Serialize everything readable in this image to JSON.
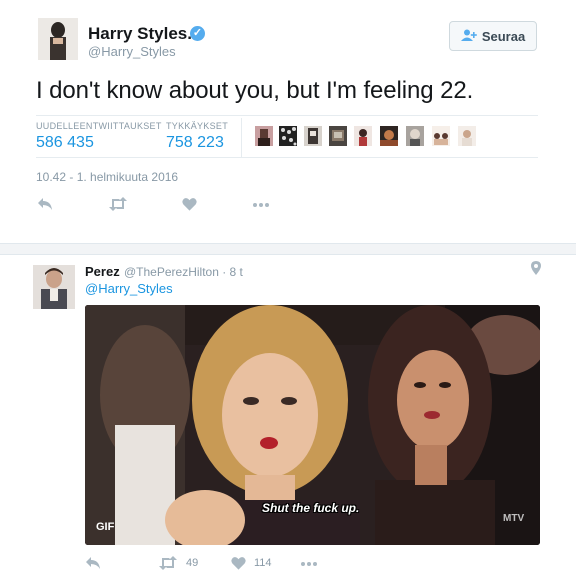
{
  "tweet": {
    "author_name": "Harry Styles.",
    "handle": "@Harry_Styles",
    "follow_label": "Seuraa",
    "text": "I don't know about you, but I'm feeling 22.",
    "retweets_label": "UUDELLEENTWIITTAUKSET",
    "retweets_value": "586 435",
    "likes_label": "TYKKÄYKSET",
    "likes_value": "758 223",
    "timestamp": "10.42 - 1. helmikuuta 2016",
    "icons": [
      "verified-icon",
      "follow-person-icon",
      "reply-icon",
      "retweet-icon",
      "like-heart-icon",
      "more-icon"
    ]
  },
  "reply": {
    "author_name": "Perez",
    "meta": "@ThePerezHilton · 8 t",
    "mention": "@Harry_Styles",
    "media_caption": "Shut the fuck up.",
    "media_badge": "GIF",
    "media_watermark": "MTV",
    "retweet_count": "49",
    "like_count": "114",
    "icons": [
      "location-pin-icon",
      "reply-icon",
      "retweet-icon",
      "like-heart-icon",
      "more-icon"
    ]
  },
  "colors": {
    "link_blue": "#1b95e0",
    "verified_blue": "#55acee",
    "muted_gray": "#8899a6",
    "icon_gray": "#aab8c2"
  }
}
